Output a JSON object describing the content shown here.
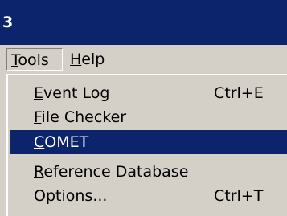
{
  "window": {
    "title": "3"
  },
  "menubar": {
    "tools": {
      "mnemonic": "T",
      "rest": "ools"
    },
    "help": {
      "mnemonic": "H",
      "rest": "elp"
    }
  },
  "tools_menu": {
    "items": [
      {
        "mnemonic": "E",
        "rest": "vent Log",
        "shortcut": "Ctrl+E",
        "highlighted": false
      },
      {
        "mnemonic": "F",
        "rest": "ile Checker",
        "shortcut": "",
        "highlighted": false
      },
      {
        "mnemonic": "C",
        "rest": "OMET",
        "shortcut": "",
        "highlighted": true
      },
      {
        "mnemonic": "R",
        "rest": "eference Database",
        "shortcut": "",
        "highlighted": false
      },
      {
        "mnemonic": "O",
        "rest": "ptions...",
        "shortcut": "Ctrl+T",
        "highlighted": false
      }
    ]
  },
  "colors": {
    "titlebar": "#0b246b",
    "menu_face": "#d4d0c8",
    "highlight": "#0b246b"
  }
}
